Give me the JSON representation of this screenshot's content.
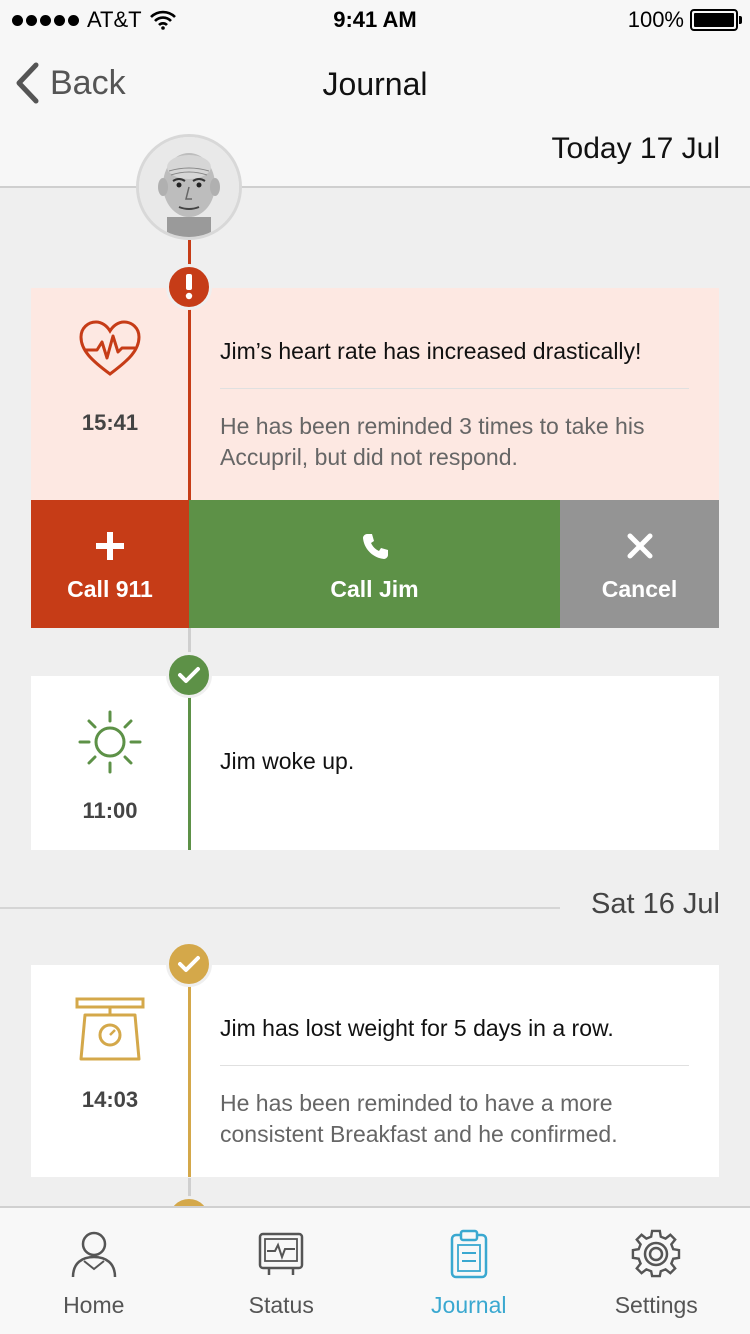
{
  "status_bar": {
    "carrier": "AT&T",
    "time": "9:41 AM",
    "battery": "100%"
  },
  "nav": {
    "back_label": "Back",
    "title": "Journal"
  },
  "sections": {
    "today_label": "Today 17 Jul",
    "saturday_label": "Sat 16 Jul"
  },
  "entries": [
    {
      "time": "15:41",
      "headline": "Jim’s heart rate has increased drastically!",
      "detail": "He has been reminded 3 times to take his Accupril, but did not respond.",
      "icon": "heart-rate-icon",
      "status": "alert"
    },
    {
      "time": "11:00",
      "headline": "Jim woke up.",
      "icon": "sun-icon",
      "status": "ok"
    },
    {
      "time": "14:03",
      "headline": "Jim has lost weight for 5 days in a row.",
      "detail": "He has been reminded to have a more consistent Breakfast and he confirmed.",
      "icon": "scale-icon",
      "status": "warning"
    }
  ],
  "actions": {
    "call911_label": "Call 911",
    "call_jim_label": "Call Jim",
    "cancel_label": "Cancel"
  },
  "tabs": [
    {
      "label": "Home",
      "icon": "person-icon"
    },
    {
      "label": "Status",
      "icon": "monitor-icon"
    },
    {
      "label": "Journal",
      "icon": "clipboard-icon",
      "active": true
    },
    {
      "label": "Settings",
      "icon": "gear-icon"
    }
  ],
  "colors": {
    "alert": "#c63c17",
    "alert_bg": "#fde8e2",
    "ok": "#5d9147",
    "warning": "#d4a84a",
    "neutral": "#949494",
    "active_tab": "#3aa8d0"
  }
}
